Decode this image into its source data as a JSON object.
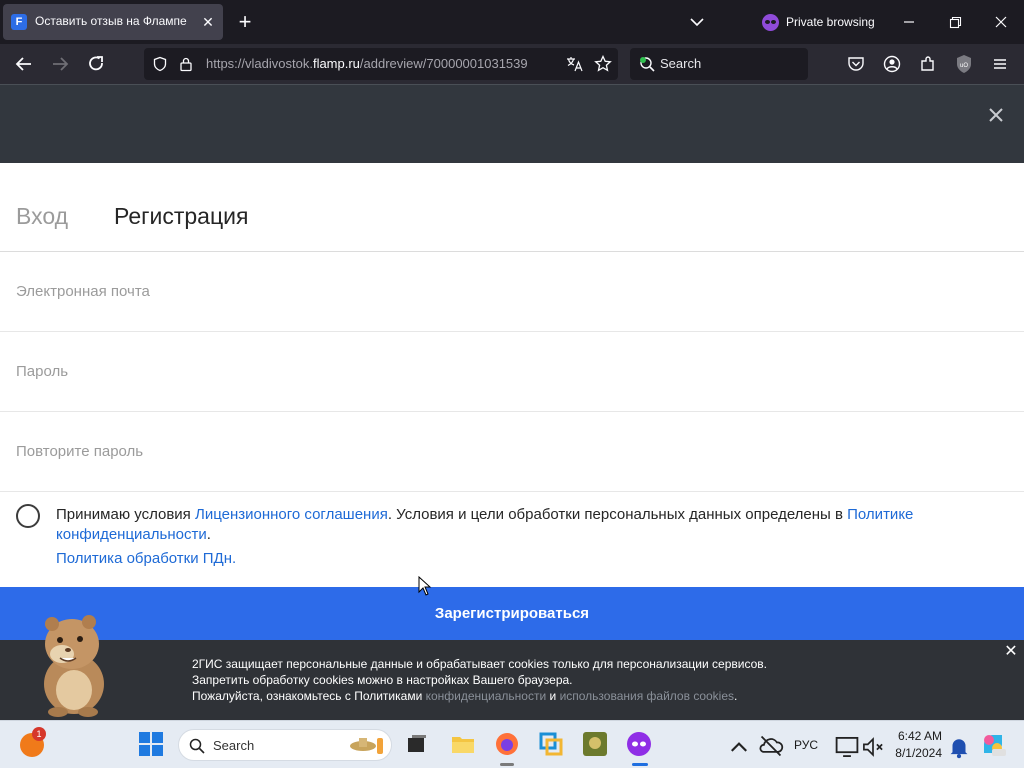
{
  "browser": {
    "tab_title": "Оставить отзыв на Флампе",
    "tab_favicon_letter": "F",
    "private_label": "Private browsing",
    "url_prefix": "https://vladivostok.",
    "url_domain": "flamp.ru",
    "url_rest": "/addreview/70000001031539",
    "search_placeholder": "Search"
  },
  "auth": {
    "tab_login": "Вход",
    "tab_register": "Регистрация",
    "email_placeholder": "Электронная почта",
    "password_placeholder": "Пароль",
    "password_repeat_placeholder": "Повторите пароль",
    "consent_prefix": "Принимаю условия ",
    "consent_link_license": "Лицензионного соглашения",
    "consent_middle": ". Условия и цели обработки персональных данных определены в ",
    "consent_link_privacy": "Политике конфиденциальности",
    "consent_suffix": ".",
    "consent_link_pd": "Политика обработки ПДн.",
    "register_button": "Зарегистрироваться"
  },
  "cookie_banner": {
    "line1": "2ГИС защищает персональные данные и обрабатывает cookies только для персонализации сервисов.",
    "line2": "Запретить обработку cookies можно в настройках Вашего браузера.",
    "line3_prefix": "Пожалуйста, ознакомьтесь с Политиками ",
    "link_privacy": "конфиденциальности",
    "line3_and": " и ",
    "link_cookies": "использования файлов cookies",
    "line3_suffix": "."
  },
  "taskbar": {
    "notification_count": "1",
    "search_label": "Search",
    "language": "РУС",
    "time": "6:42 AM",
    "date": "8/1/2024"
  },
  "colors": {
    "primary_button": "#2d6be9",
    "link": "#1e6ad6",
    "modal_header": "#32373e",
    "browser_dark": "#1c1b22"
  }
}
